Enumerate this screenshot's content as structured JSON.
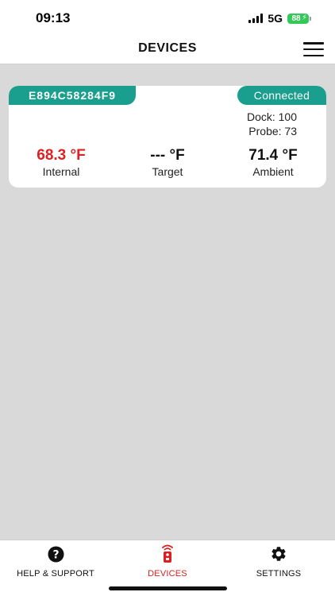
{
  "status_bar": {
    "time": "09:13",
    "network": "5G",
    "battery": "88"
  },
  "header": {
    "title": "DEVICES",
    "menu_icon": "hamburger-menu-icon"
  },
  "device": {
    "id": "E894C58284F9",
    "status": "Connected",
    "dock": "Dock: 100",
    "probe": "Probe: 73",
    "readings": {
      "internal": {
        "value": "68.3 °F",
        "label": "Internal",
        "color": "#e02020"
      },
      "target": {
        "value": "--- °F",
        "label": "Target"
      },
      "ambient": {
        "value": "71.4 °F",
        "label": "Ambient"
      }
    },
    "accent_color": "#1a9e8d"
  },
  "bottom_nav": {
    "help": {
      "label": "HELP & SUPPORT",
      "icon": "help-circle-icon"
    },
    "devices": {
      "label": "DEVICES",
      "icon": "thermometer-remote-icon",
      "active": true
    },
    "settings": {
      "label": "SETTINGS",
      "icon": "gear-icon"
    }
  }
}
